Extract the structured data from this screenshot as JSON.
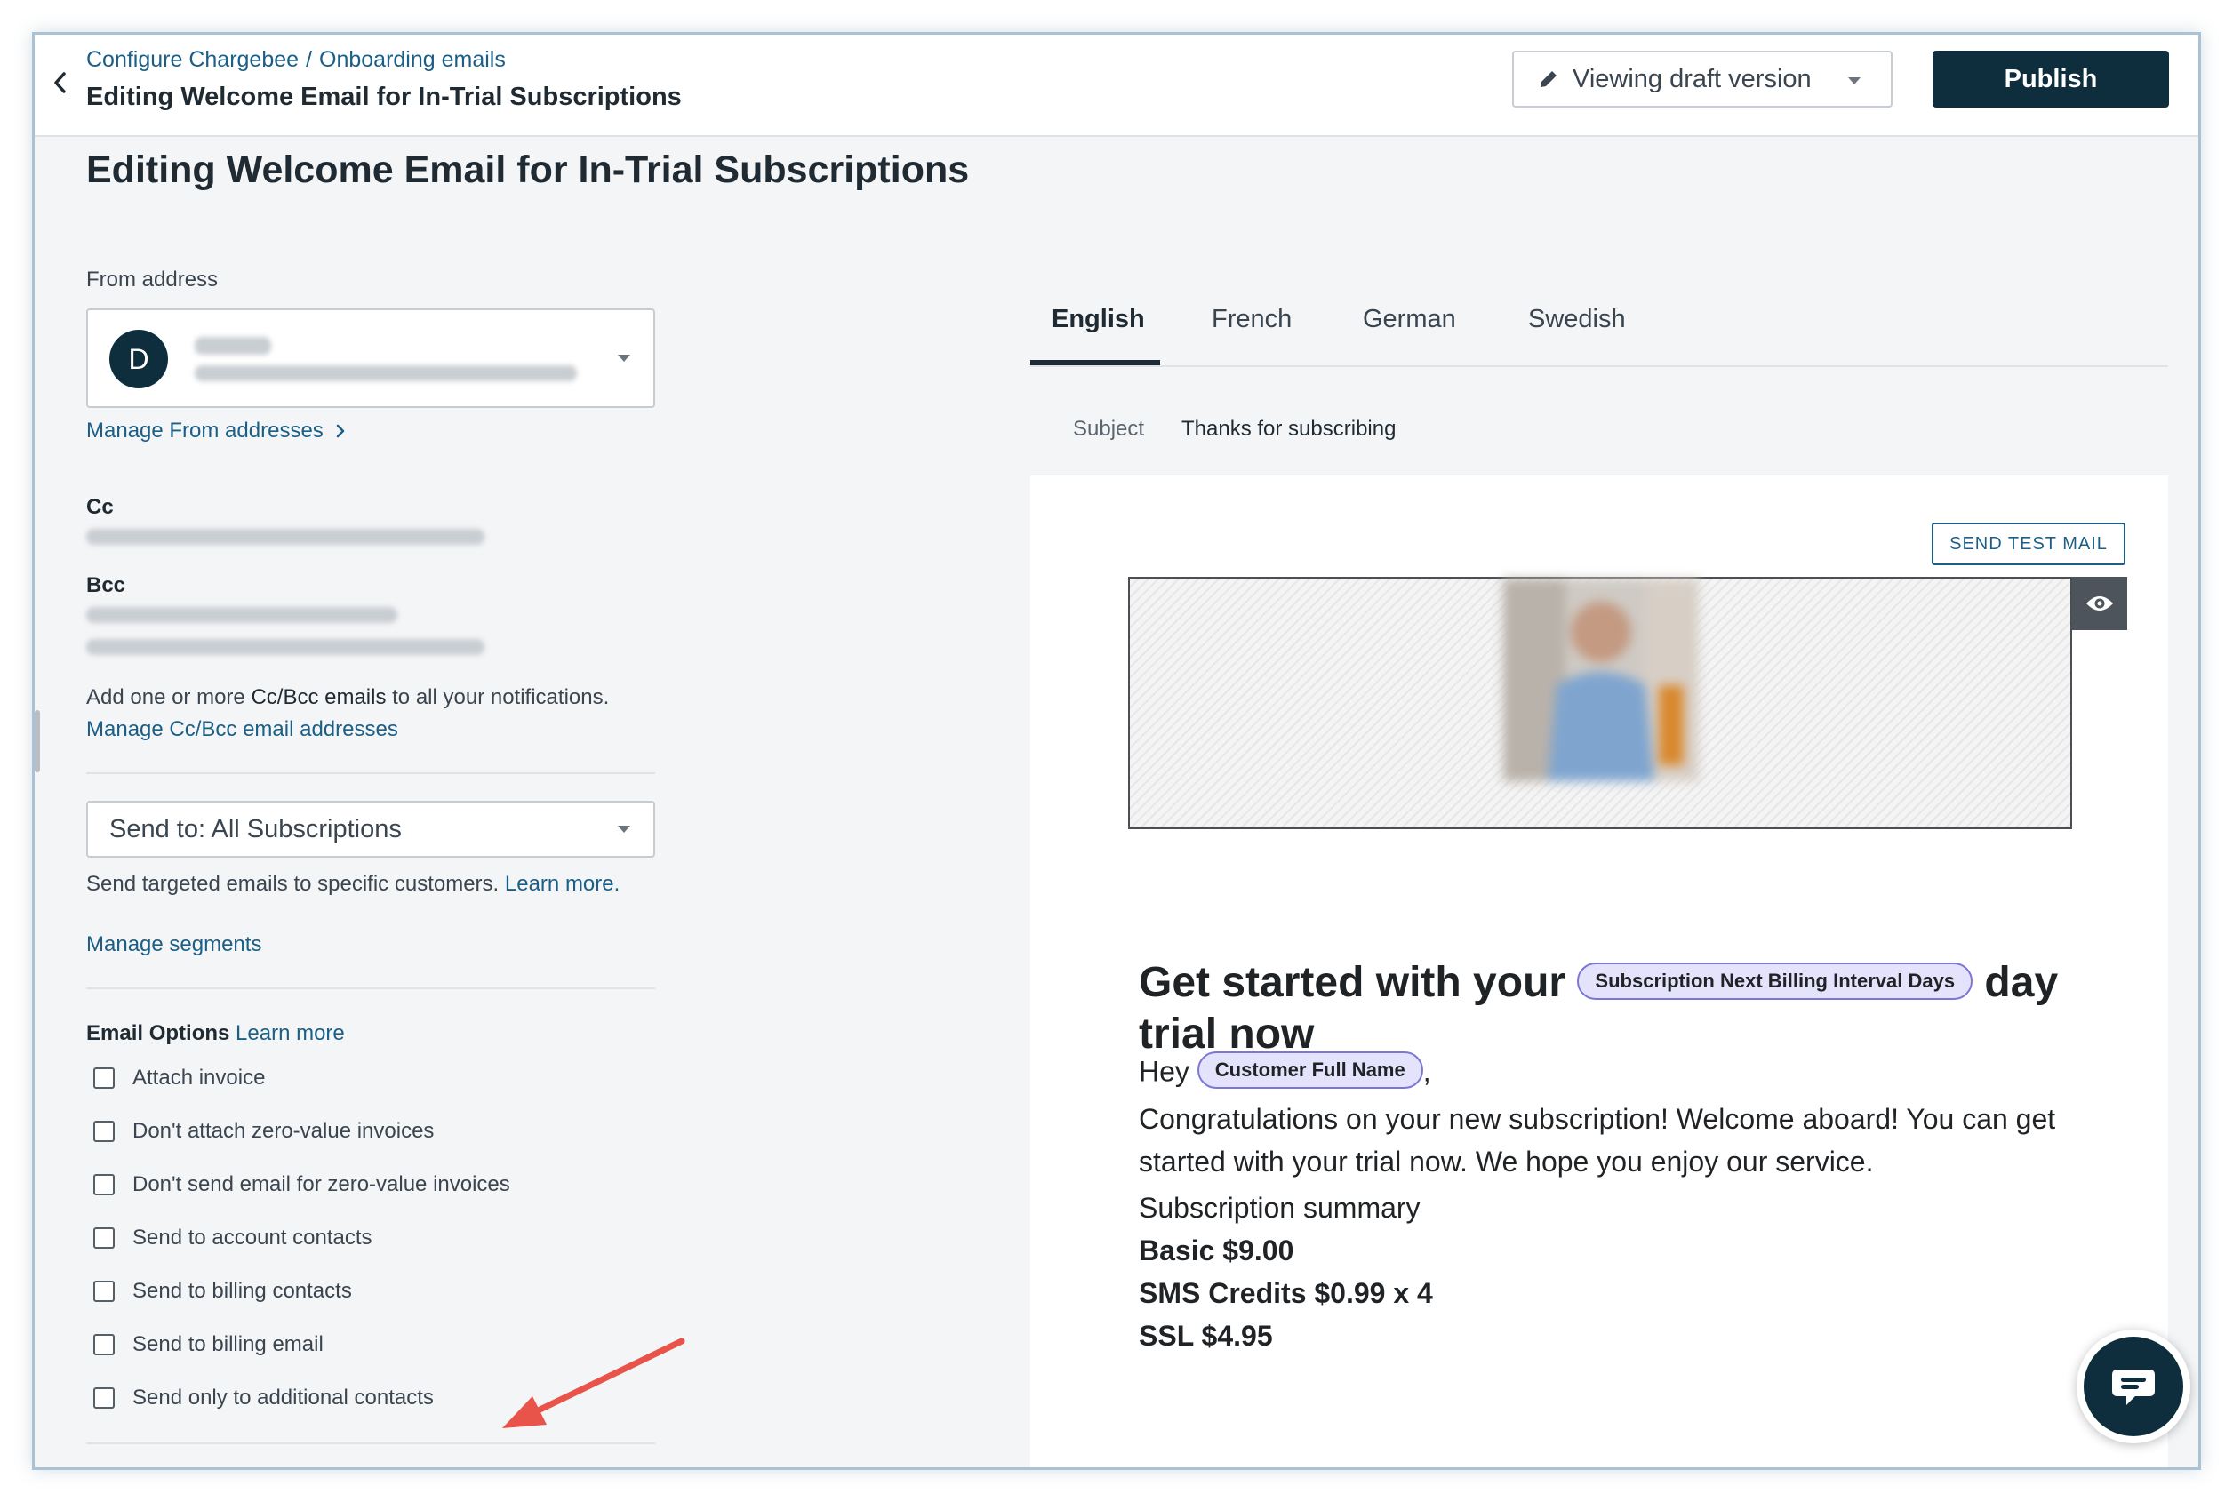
{
  "colors": {
    "primary_dark": "#0e2d3d",
    "link": "#1b5f87",
    "placeholder_chip_bg": "#e4e3fb",
    "placeholder_chip_border": "#7b77d9",
    "annotation_arrow": "#e8534a"
  },
  "header": {
    "breadcrumb": [
      "Configure Chargebee",
      "Onboarding emails"
    ],
    "breadcrumb_separator": "/",
    "title": "Editing Welcome Email for In-Trial Subscriptions",
    "version_select": "Viewing draft version",
    "publish_label": "Publish",
    "back_icon": "chevron-left-icon"
  },
  "page": {
    "title": "Editing Welcome Email for In-Trial Subscriptions"
  },
  "settings": {
    "from_address_label": "From address",
    "from_avatar_initial": "D",
    "manage_from_link": "Manage From addresses",
    "cc_label": "Cc",
    "bcc_label": "Bcc",
    "cc_note_prefix": "Add one or more ",
    "cc_note_emph": "Cc/Bcc emails",
    "cc_note_suffix": " to all your notifications.",
    "manage_cc_link": "Manage Cc/Bcc email addresses",
    "send_to_select": "Send to: All Subscriptions",
    "targeted_note": "Send targeted emails to specific customers.",
    "learn_more": "Learn more.",
    "manage_segments": "Manage segments",
    "email_options_label": "Email Options",
    "email_options_learn": "Learn more",
    "options": [
      {
        "label": "Attach invoice",
        "checked": false
      },
      {
        "label": "Don't attach zero-value invoices",
        "checked": false
      },
      {
        "label": "Don't send email for zero-value invoices",
        "checked": false
      },
      {
        "label": "Send to account contacts",
        "checked": false
      },
      {
        "label": "Send to billing contacts",
        "checked": false
      },
      {
        "label": "Send to billing email",
        "checked": false
      },
      {
        "label": "Send only to additional contacts",
        "checked": false
      }
    ]
  },
  "preview": {
    "tabs": [
      "English",
      "French",
      "German",
      "Swedish"
    ],
    "active_tab": "English",
    "subject_label": "Subject",
    "subject_value": "Thanks for subscribing",
    "send_test_label": "SEND TEST MAIL",
    "headline_before": "Get started with your",
    "headline_chip": "Subscription Next Billing Interval Days",
    "headline_after": "day trial now",
    "greeting": "Hey",
    "greeting_chip": "Customer Full Name",
    "greeting_suffix": ",",
    "body": "Congratulations on your new subscription! Welcome aboard! You can get started with your trial now. We hope you enjoy our service.",
    "summary_title": "Subscription summary",
    "summary_lines": [
      "Basic $9.00",
      "SMS Credits $0.99 x 4",
      "SSL $4.95"
    ]
  }
}
